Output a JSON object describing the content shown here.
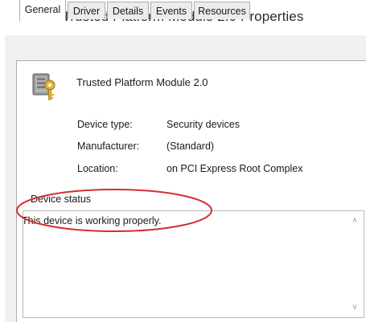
{
  "window": {
    "title": "Trusted Platform Module 2.0 Properties"
  },
  "tabs": [
    {
      "label": "General",
      "active": true
    },
    {
      "label": "Driver",
      "active": false
    },
    {
      "label": "Details",
      "active": false
    },
    {
      "label": "Events",
      "active": false
    },
    {
      "label": "Resources",
      "active": false
    }
  ],
  "device": {
    "name": "Trusted Platform Module 2.0",
    "icon": "tpm-chip-key-icon"
  },
  "properties": [
    {
      "label": "Device type:",
      "value": "Security devices"
    },
    {
      "label": "Manufacturer:",
      "value": "(Standard)"
    },
    {
      "label": "Location:",
      "value": "on PCI Express Root Complex"
    }
  ],
  "device_status": {
    "group_label": "Device status",
    "text": "This device is working properly."
  },
  "annotation": {
    "shape": "ellipse",
    "color": "#d32f2f"
  }
}
